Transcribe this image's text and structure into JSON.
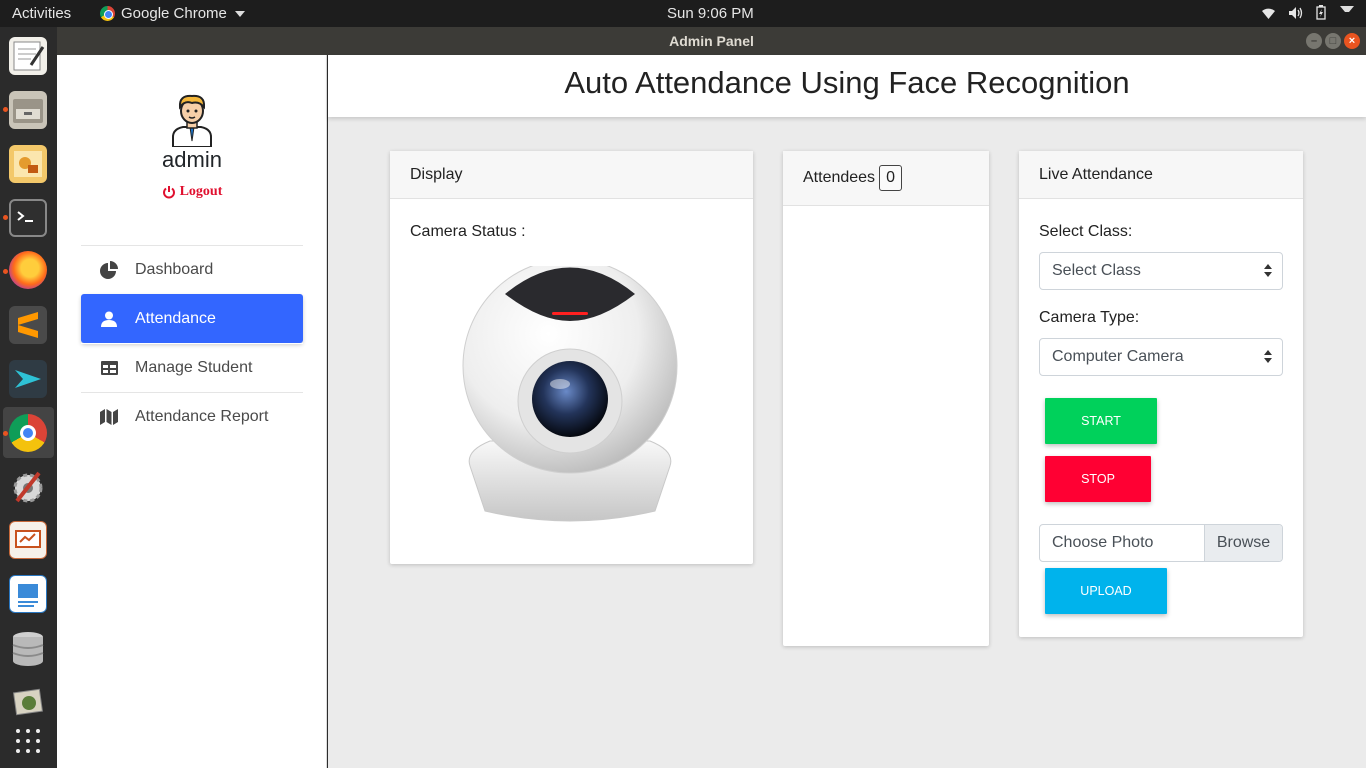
{
  "topbar": {
    "activities": "Activities",
    "app_name": "Google Chrome",
    "clock": "Sun  9:06 PM"
  },
  "window": {
    "title": "Admin Panel"
  },
  "dock": {
    "items": [
      "text-editor-icon",
      "file-cabinet-icon",
      "image-viewer-icon",
      "terminal-icon",
      "firefox-icon",
      "sublime-text-icon",
      "remote-desktop-icon",
      "chrome-icon",
      "settings-tools-icon",
      "presentation-icon",
      "document-icon",
      "database-icon",
      "photos-icon"
    ],
    "active": "chrome-icon"
  },
  "sidebar": {
    "username": "admin",
    "logout_label": "Logout",
    "nav": [
      {
        "label": "Dashboard",
        "icon": "pie-chart-icon"
      },
      {
        "label": "Attendance",
        "icon": "user-icon",
        "active": true
      },
      {
        "label": "Manage Student",
        "icon": "table-icon"
      },
      {
        "label": "Attendance Report",
        "icon": "map-icon"
      }
    ]
  },
  "header": {
    "title": "Auto Attendance Using Face Recognition"
  },
  "display": {
    "header": "Display",
    "camera_status_label": "Camera Status :"
  },
  "attendees": {
    "header": "Attendees",
    "count": "0"
  },
  "live": {
    "header": "Live Attendance",
    "select_class_label": "Select Class:",
    "select_class_value": "Select Class",
    "camera_type_label": "Camera Type:",
    "camera_type_value": "Computer Camera",
    "start_label": "START",
    "stop_label": "STOP",
    "choose_photo": "Choose Photo",
    "browse_label": "Browse",
    "upload_label": "UPLOAD"
  },
  "colors": {
    "active_nav": "#3366ff",
    "start": "#00d15b",
    "stop": "#ff0033",
    "upload": "#00b3ec",
    "logout": "#e0102f"
  }
}
